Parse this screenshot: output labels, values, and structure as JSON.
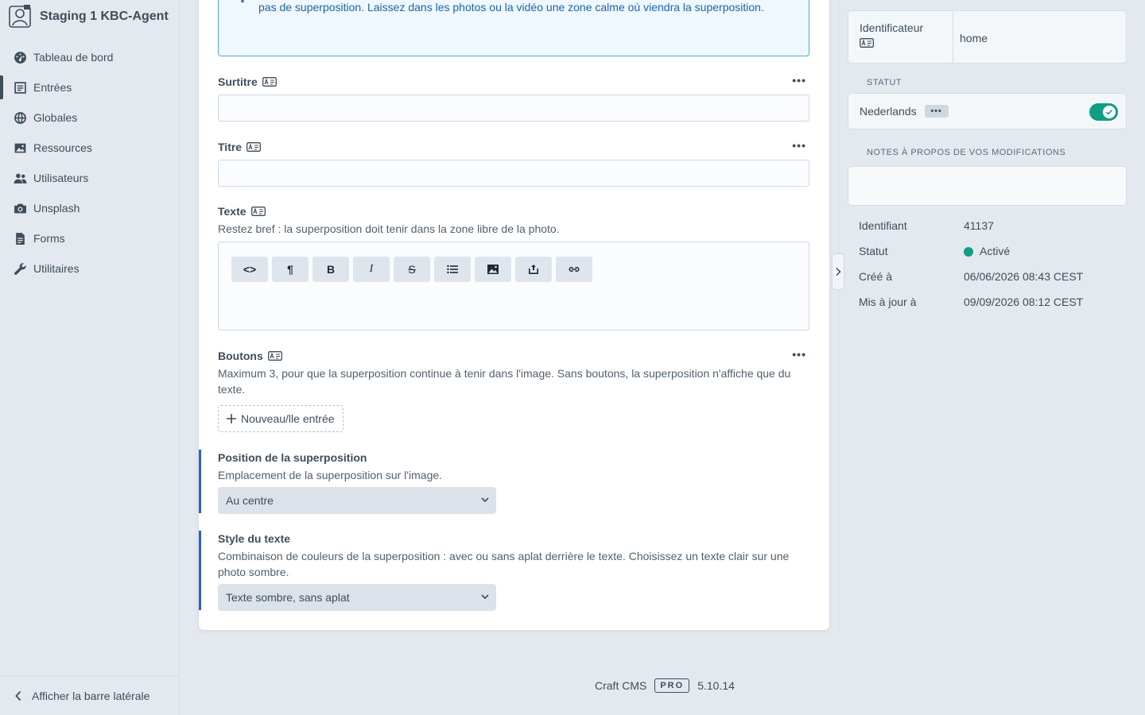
{
  "app": {
    "name": "Staging 1 KBC-Agent"
  },
  "nav": {
    "items": [
      {
        "label": "Tableau de bord",
        "icon": "dashboard-icon",
        "active": false
      },
      {
        "label": "Entrées",
        "icon": "entries-icon",
        "active": true
      },
      {
        "label": "Globales",
        "icon": "globe-icon",
        "active": false
      },
      {
        "label": "Ressources",
        "icon": "image-icon",
        "active": false
      },
      {
        "label": "Utilisateurs",
        "icon": "users-icon",
        "active": false
      },
      {
        "label": "Unsplash",
        "icon": "camera-icon",
        "active": false
      },
      {
        "label": "Forms",
        "icon": "document-icon",
        "active": false
      },
      {
        "label": "Utilitaires",
        "icon": "wrench-icon",
        "active": false
      }
    ],
    "toggle_label": "Afficher la barre latérale"
  },
  "info": {
    "text": "La même superposition que le bloc « Photo avec superposition », ici sur l'en-tête. Tout est facultatif : vide = pas de superposition. Laissez dans les photos ou la vidéo une zone calme où viendra la superposition."
  },
  "fields": {
    "surtitre": {
      "label": "Surtitre"
    },
    "titre": {
      "label": "Titre"
    },
    "texte": {
      "label": "Texte",
      "instructions": "Restez bref : la superposition doit tenir dans la zone libre de la photo."
    },
    "boutons": {
      "label": "Boutons",
      "instructions": "Maximum 3, pour que la superposition continue à tenir dans l'image. Sans boutons, la superposition n'affiche que du texte.",
      "add_label": "Nouveau/lle entrée"
    },
    "position": {
      "label": "Position de la superposition",
      "instructions": "Emplacement de la superposition sur l'image.",
      "value": "Au centre"
    },
    "style": {
      "label": "Style du texte",
      "instructions": "Combinaison de couleurs de la superposition : avec ou sans aplat derrière le texte. Choisissez un texte clair sur une photo sombre.",
      "value": "Texte sombre, sans aplat"
    }
  },
  "rte": {
    "buttons": [
      {
        "name": "code-view-button",
        "glyph": "<>"
      },
      {
        "name": "paragraph-button",
        "glyph": "¶"
      },
      {
        "name": "bold-button",
        "glyph": "B"
      },
      {
        "name": "italic-button",
        "glyph": "I"
      },
      {
        "name": "strikethrough-button",
        "glyph": "S"
      }
    ]
  },
  "sidebar_right": {
    "slug_label": "Identificateur",
    "slug_value": "home",
    "status_heading": "STATUT",
    "site_name": "Nederlands",
    "site_enabled": true,
    "notes_heading": "NOTES À PROPOS DE VOS MODIFICATIONS",
    "meta": [
      {
        "key": "Identifiant",
        "value": "41137"
      },
      {
        "key": "Statut",
        "value": "Activé",
        "dot": "#0f9f86"
      },
      {
        "key": "Créé à",
        "value": "06/06/2026 08:43 CEST"
      },
      {
        "key": "Mis à jour à",
        "value": "09/09/2026 08:12 CEST"
      }
    ]
  },
  "footer": {
    "product": "Craft CMS",
    "edition": "PRO",
    "version": "5.10.14"
  },
  "colors": {
    "accent": "#2f5ec2",
    "success": "#0f9f86",
    "info_border": "#5aa7d6"
  }
}
